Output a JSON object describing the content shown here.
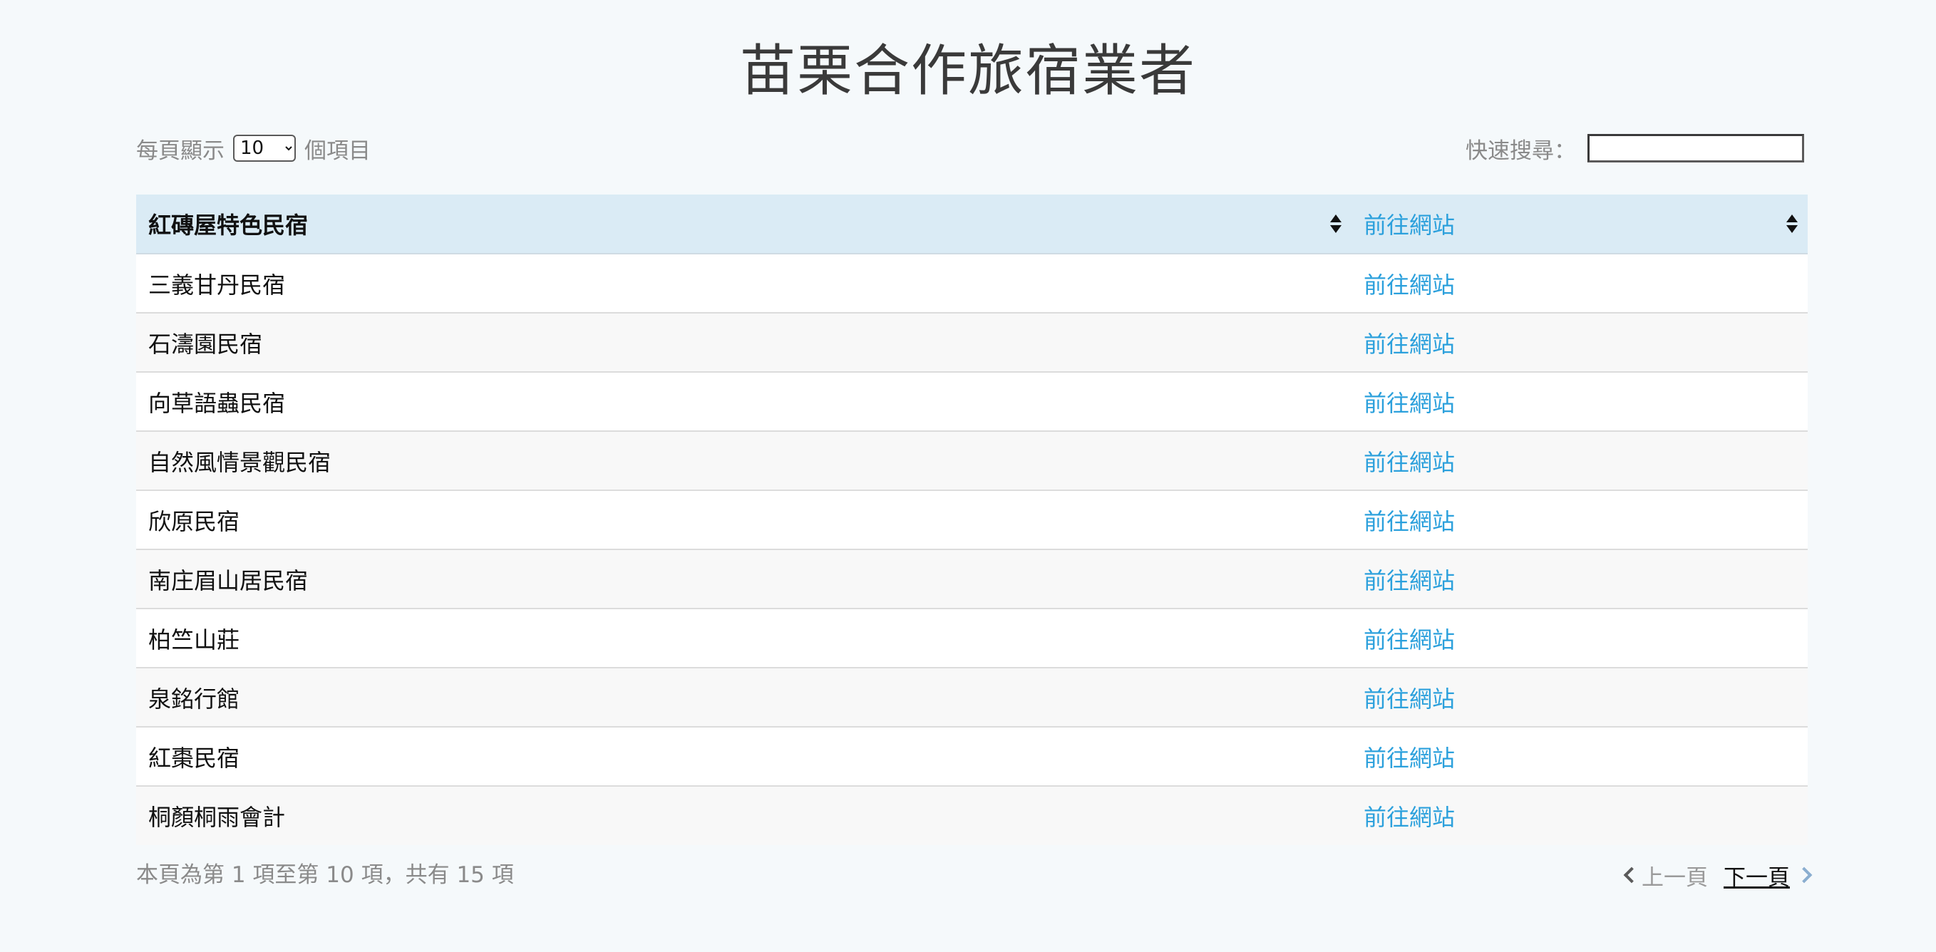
{
  "page": {
    "title": "苗栗合作旅宿業者"
  },
  "length_control": {
    "prefix": "每頁顯示",
    "selected": "10",
    "options": [
      "10"
    ],
    "suffix": "個項目"
  },
  "search": {
    "label": "快速搜尋：",
    "value": "",
    "placeholder": ""
  },
  "table": {
    "header": {
      "name": "紅磚屋特色民宿",
      "link": "前往網站"
    },
    "rows": [
      {
        "name": "三義甘丹民宿",
        "link": "前往網站"
      },
      {
        "name": "石濤園民宿",
        "link": "前往網站"
      },
      {
        "name": "向草語蟲民宿",
        "link": "前往網站"
      },
      {
        "name": "自然風情景觀民宿",
        "link": "前往網站"
      },
      {
        "name": "欣原民宿",
        "link": "前往網站"
      },
      {
        "name": "南庄眉山居民宿",
        "link": "前往網站"
      },
      {
        "name": "柏竺山莊",
        "link": "前往網站"
      },
      {
        "name": "泉銘行館",
        "link": "前往網站"
      },
      {
        "name": "紅棗民宿",
        "link": "前往網站"
      },
      {
        "name": "桐顏桐雨會計",
        "link": "前往網站"
      }
    ]
  },
  "info": {
    "text": "本頁為第 1 項至第 10 項，共有 15 項"
  },
  "pagination": {
    "prev_label": "上一頁",
    "next_label": "下一頁"
  },
  "colors": {
    "background": "#f5f9fb",
    "header_bg": "#daebf5",
    "link": "#2ba0dc",
    "muted_text": "#8a8a8a"
  },
  "icons": [
    "sort-icon",
    "chevron-left-icon",
    "chevron-right-icon"
  ]
}
